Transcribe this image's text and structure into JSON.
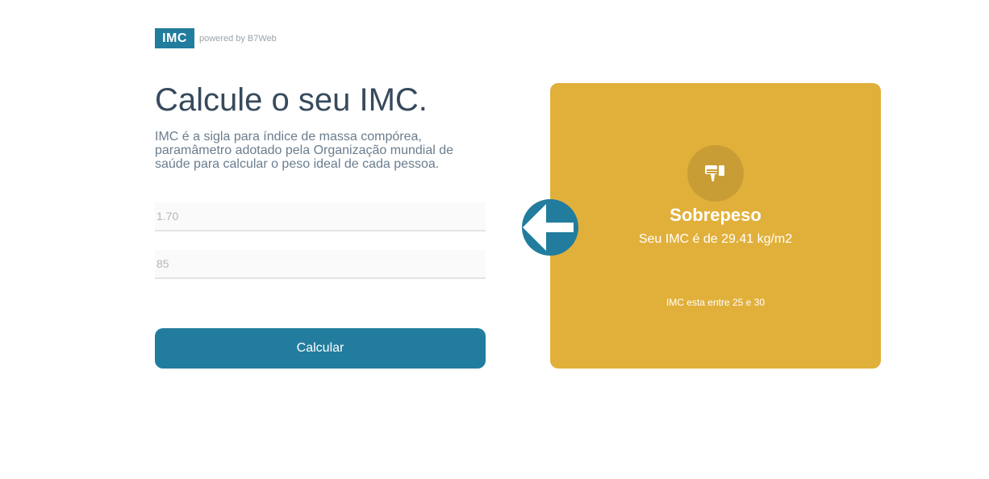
{
  "header": {
    "logo_text": "IMC",
    "powered_by": "powered by B7Web"
  },
  "intro": {
    "title": "Calcule o seu IMC.",
    "description": "IMC é a sigla para índice de massa compórea, paramâmetro adotado pela Organização mundial de saúde para calcular o peso ideal de cada pessoa."
  },
  "form": {
    "height_value": "1.70",
    "weight_value": "85",
    "submit_label": "Calcular"
  },
  "result": {
    "icon": "thumbs-down-icon",
    "title": "Sobrepeso",
    "value_text": "Seu IMC é de 29.41 kg/m2",
    "range_text": "IMC esta entre 25 e 30",
    "background_color": "#e1b03b"
  },
  "colors": {
    "primary": "#227c9d",
    "title_text": "#374a5c"
  }
}
